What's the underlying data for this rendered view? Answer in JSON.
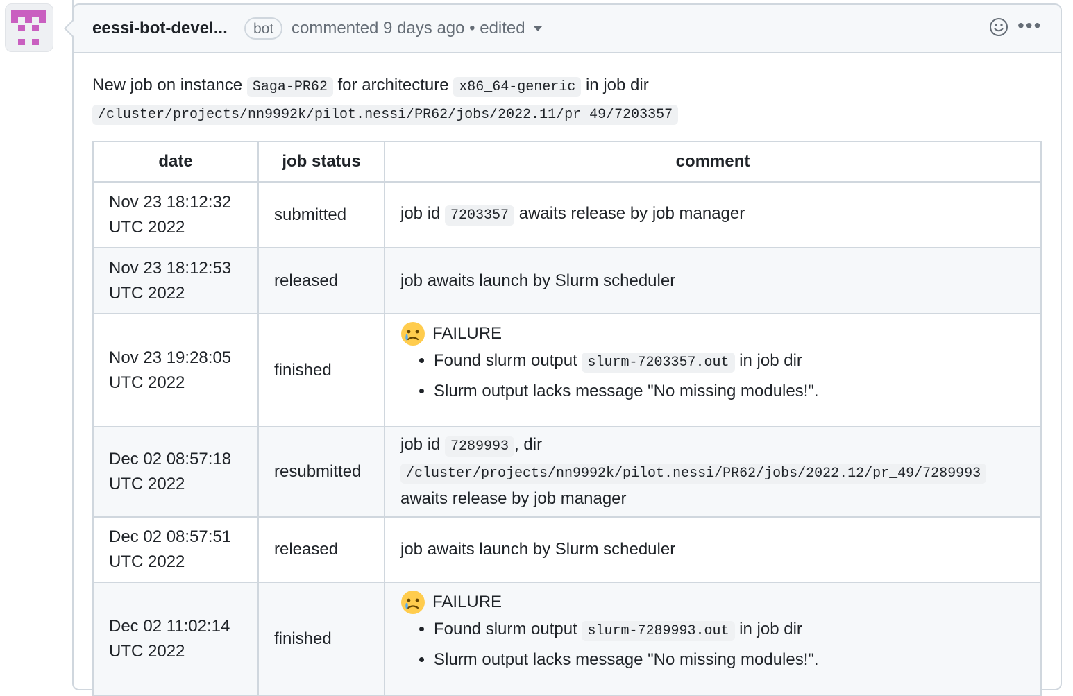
{
  "comment": {
    "author": "eessi-bot-devel...",
    "bot_badge": "bot",
    "meta_text": "commented 9 days ago • edited",
    "intro": {
      "prefix": "New job on instance",
      "instance": "Saga-PR62",
      "middle": "for architecture",
      "architecture": "x86_64-generic",
      "suffix": "in job dir",
      "job_dir": "/cluster/projects/nn9992k/pilot.nessi/PR62/jobs/2022.11/pr_49/7203357"
    },
    "table": {
      "headers": [
        "date",
        "job status",
        "comment"
      ],
      "rows": [
        {
          "date_line1": "Nov 23 18:12:32",
          "date_line2": "UTC 2022",
          "status": "submitted",
          "pre": "job id",
          "code": "7203357",
          "post": "awaits release by job manager"
        },
        {
          "date_line1": "Nov 23 18:12:53",
          "date_line2": "UTC 2022",
          "status": "released",
          "text": "job awaits launch by Slurm scheduler"
        },
        {
          "date_line1": "Nov 23 19:28:05",
          "date_line2": "UTC 2022",
          "status": "finished",
          "failure_label": "FAILURE",
          "bullet1_pre": "Found slurm output",
          "bullet1_code": "slurm-7203357.out",
          "bullet1_post": "in job dir",
          "bullet2": "Slurm output lacks message \"No missing modules!\"."
        },
        {
          "date_line1": "Dec 02 08:57:18",
          "date_line2": "UTC 2022",
          "status": "resubmitted",
          "pre": "job id",
          "code": "7289993",
          "mid": ", dir",
          "dir": "/cluster/projects/nn9992k/pilot.nessi/PR62/jobs/2022.12/pr_49/7289993",
          "post": "awaits release by job manager"
        },
        {
          "date_line1": "Dec 02 08:57:51",
          "date_line2": "UTC 2022",
          "status": "released",
          "text": "job awaits launch by Slurm scheduler"
        },
        {
          "date_line1": "Dec 02 11:02:14",
          "date_line2": "UTC 2022",
          "status": "finished",
          "failure_label": "FAILURE",
          "bullet1_pre": "Found slurm output",
          "bullet1_code": "slurm-7289993.out",
          "bullet1_post": "in job dir",
          "bullet2": "Slurm output lacks message \"No missing modules!\"."
        }
      ]
    }
  },
  "icons": {
    "avatar": "identicon-avatar",
    "reaction": "smiley-icon",
    "menu": "kebab-menu-icon",
    "failure": "crying-face-emoji"
  },
  "colors": {
    "avatar_accent": "#c95fc0",
    "border": "#d0d7de",
    "muted_text": "#656d76",
    "code_bg": "#eff1f3"
  }
}
